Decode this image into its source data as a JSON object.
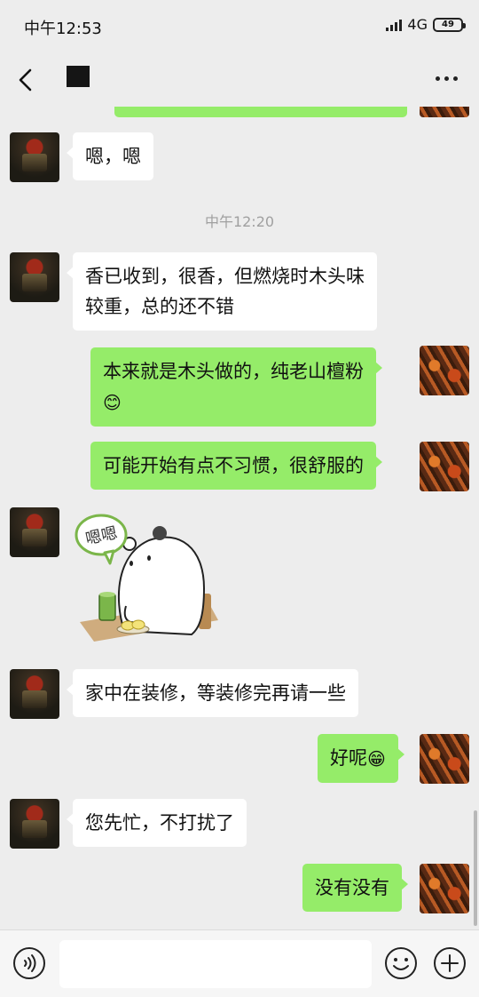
{
  "status_bar": {
    "time": "中午12:53",
    "network": "4G",
    "battery": "49"
  },
  "nav": {
    "title": ""
  },
  "timestamp": "中午12:20",
  "messages": {
    "m1": {
      "text": "嗯，嗯"
    },
    "m2": {
      "line1": "香已收到，很香，但燃烧时木头味",
      "line2": "较重，总的还不错"
    },
    "m3": {
      "line1": "本来就是木头做的，纯老山檀粉",
      "emoji": "😊"
    },
    "m4": {
      "text": "可能开始有点不习惯，很舒服的"
    },
    "m5": {
      "sticker_text": "嗯嗯"
    },
    "m6": {
      "text": "家中在装修，等装修完再请一些"
    },
    "m7": {
      "text": "好呢",
      "emoji": "😁"
    },
    "m8": {
      "text": "您先忙，不打扰了"
    },
    "m9": {
      "text": "没有没有"
    }
  },
  "input": {
    "placeholder": ""
  },
  "icons": {
    "back": "chevron-left-icon",
    "more": "more-horizontal-icon",
    "voice": "voice-icon",
    "emoji": "emoji-icon",
    "plus": "plus-icon"
  },
  "colors": {
    "self_bubble": "#95ec69",
    "other_bubble": "#ffffff",
    "background": "#ededed"
  }
}
